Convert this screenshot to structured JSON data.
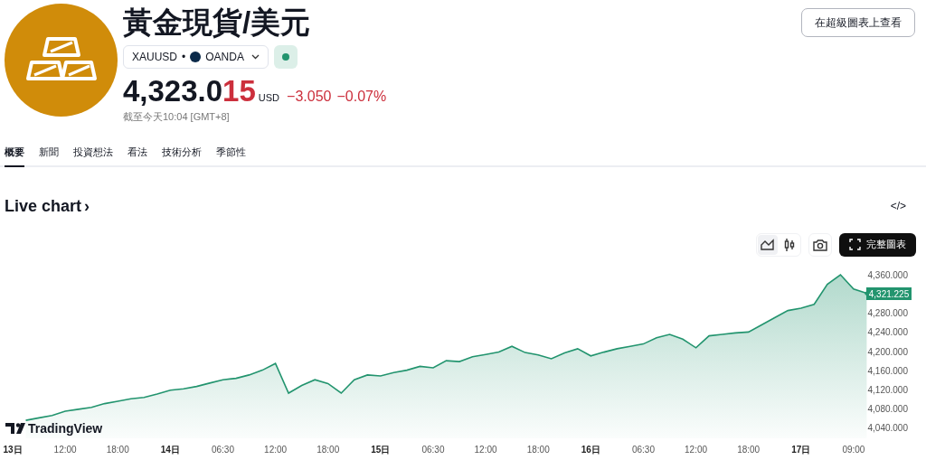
{
  "header": {
    "title": "黃金現貨/美元",
    "symbol": "XAUUSD",
    "separator": "•",
    "exchange": "OANDA",
    "market_open": true,
    "price_main": "4,323.0",
    "price_highlight": "15",
    "currency": "USD",
    "change": "−3.050",
    "change_percent": "−0.07%",
    "timestamp": "截至今天10:04 [GMT+8]",
    "supercharts_button": "在超級圖表上查看"
  },
  "tabs": [
    {
      "label": "概要",
      "selected": true
    },
    {
      "label": "新聞",
      "selected": false
    },
    {
      "label": "投資想法",
      "selected": false
    },
    {
      "label": "看法",
      "selected": false
    },
    {
      "label": "技術分析",
      "selected": false
    },
    {
      "label": "季節性",
      "selected": false
    }
  ],
  "section_title": "Live chart",
  "section_chevron": "›",
  "embed_icon": "</>",
  "chart_toolbar": [
    {
      "kind": "area",
      "selected": true
    },
    {
      "kind": "candles",
      "selected": false
    },
    {
      "kind": "snapshot",
      "selected": false
    }
  ],
  "fullscreen_button": "完整圖表",
  "watermark": "TradingView",
  "last_price_label": "4,321.225",
  "x_axis_label_bold": [
    true,
    false,
    false,
    true,
    false,
    false,
    false,
    true,
    false,
    false,
    false,
    true,
    false,
    false,
    false,
    true,
    false
  ],
  "chart_data": {
    "type": "area",
    "categories": [
      "13日",
      null,
      null,
      null,
      "12:00",
      null,
      null,
      null,
      "18:00",
      null,
      null,
      null,
      "14日",
      null,
      null,
      null,
      "06:30",
      null,
      null,
      null,
      "12:00",
      null,
      null,
      null,
      "18:00",
      null,
      null,
      null,
      "15日",
      null,
      null,
      null,
      "06:30",
      null,
      null,
      null,
      "12:00",
      null,
      null,
      null,
      "18:00",
      null,
      null,
      null,
      "16日",
      null,
      null,
      null,
      "06:30",
      null,
      null,
      null,
      "12:00",
      null,
      null,
      null,
      "18:00",
      null,
      null,
      null,
      "17日",
      null,
      null,
      null,
      "09:00",
      null
    ],
    "series": [
      {
        "color": "#22946e",
        "values": [
          null,
          4055,
          4060,
          4065,
          4074,
          4078,
          4082,
          4090,
          4095,
          4100,
          4103,
          4110,
          4118,
          4121,
          4126,
          4133,
          4140,
          4143,
          4150,
          4160,
          4174,
          4112,
          4128,
          4140,
          4132,
          4112,
          4140,
          4150,
          4148,
          4155,
          4160,
          4168,
          4165,
          4180,
          4178,
          4188,
          4193,
          4198,
          4210,
          4197,
          4192,
          4184,
          4196,
          4205,
          4190,
          4198,
          4205,
          4210,
          4215,
          4228,
          4235,
          4225,
          4207,
          4232,
          4235,
          4238,
          4240,
          4255,
          4270,
          4285,
          4290,
          4298,
          4340,
          4360,
          4330,
          4321
        ]
      }
    ],
    "ylim": [
      4040,
      4360
    ],
    "yticks": [
      {
        "value": 4360,
        "label": "4,360.000"
      },
      {
        "value": 4280,
        "label": "4,280.000"
      },
      {
        "value": 4240,
        "label": "4,240.000"
      },
      {
        "value": 4200,
        "label": "4,200.000"
      },
      {
        "value": 4160,
        "label": "4,160.000"
      },
      {
        "value": 4120,
        "label": "4,120.000"
      },
      {
        "value": 4080,
        "label": "4,080.000"
      },
      {
        "value": 4040,
        "label": "4,040.000"
      }
    ]
  }
}
